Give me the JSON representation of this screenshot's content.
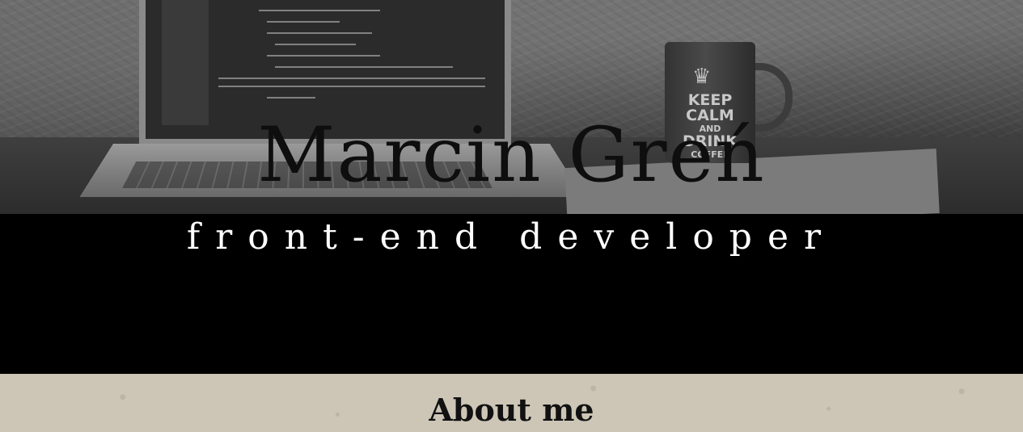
{
  "hero": {
    "name": "Marcin Greń",
    "role": "front-end developer",
    "mug_text": {
      "line1": "KEEP",
      "line2": "CALM",
      "line3": "AND",
      "line4": "DRINK",
      "line5": "COFFEE"
    }
  },
  "about": {
    "heading": "About me"
  },
  "colors": {
    "band": "#000000",
    "about_bg": "#cdc6b6",
    "name_text": "#0e0e0e",
    "role_text": "#ffffff"
  },
  "icons": {
    "mug_crown": "crown-icon"
  }
}
